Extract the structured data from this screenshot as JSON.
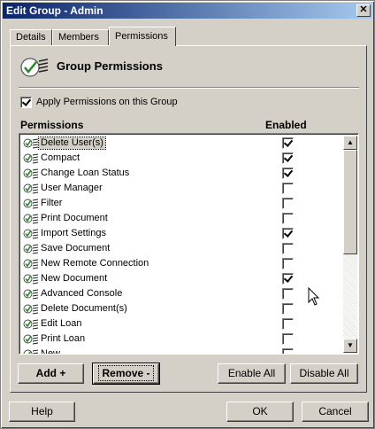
{
  "window": {
    "title": "Edit Group - Admin",
    "close_glyph": "✕"
  },
  "tabs": [
    {
      "label": "Details"
    },
    {
      "label": "Members"
    },
    {
      "label": "Permissions",
      "active": true
    }
  ],
  "header": {
    "title": "Group Permissions",
    "icon": "permissions-check-icon"
  },
  "apply": {
    "label": "Apply Permissions on this Group",
    "checked": true
  },
  "columns": {
    "permissions": "Permissions",
    "enabled": "Enabled"
  },
  "permissions": [
    {
      "label": "Delete User(s)",
      "enabled": true,
      "selected": true
    },
    {
      "label": "Compact",
      "enabled": true
    },
    {
      "label": "Change Loan Status",
      "enabled": true
    },
    {
      "label": "User Manager",
      "enabled": false
    },
    {
      "label": "Filter",
      "enabled": false
    },
    {
      "label": "Print Document",
      "enabled": false
    },
    {
      "label": "Import Settings",
      "enabled": true
    },
    {
      "label": "Save Document",
      "enabled": false
    },
    {
      "label": "New Remote Connection",
      "enabled": false
    },
    {
      "label": "New Document",
      "enabled": true
    },
    {
      "label": "Advanced Console",
      "enabled": false
    },
    {
      "label": "Delete Document(s)",
      "enabled": false
    },
    {
      "label": "Edit Loan",
      "enabled": false
    },
    {
      "label": "Print Loan",
      "enabled": false
    },
    {
      "label": "New...",
      "enabled": false
    }
  ],
  "buttons": {
    "add": "Add +",
    "remove": "Remove -",
    "enable_all": "Enable All",
    "disable_all": "Disable All",
    "help": "Help",
    "ok": "OK",
    "cancel": "Cancel"
  }
}
